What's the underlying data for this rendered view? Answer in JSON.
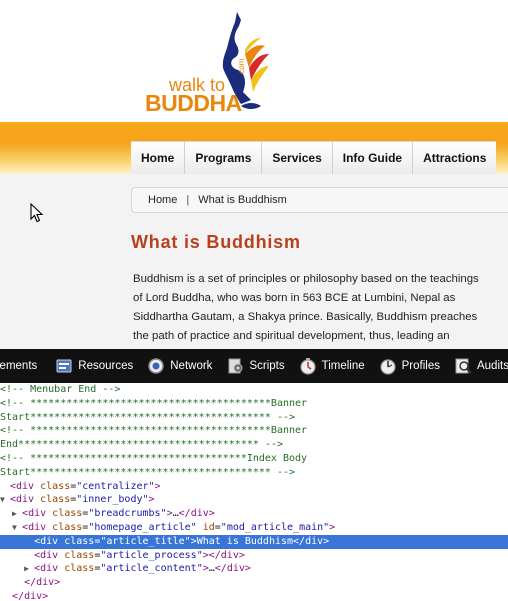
{
  "site": {
    "logo": {
      "line1": "walk to",
      "line2": "BUDDHA",
      "suffix": ".com"
    },
    "nav": [
      "Home",
      "Programs",
      "Services",
      "Info Guide",
      "Attractions"
    ],
    "breadcrumb": {
      "home": "Home",
      "separator": "|",
      "current": "What is Buddhism"
    },
    "title": "What is Buddhism",
    "article_lines": [
      "Buddhism is a set of principles or philosophy based on the teachings",
      "of Lord Buddha, who was born in 563 BCE at Lumbini, Nepal as",
      "Siddhartha Gautam, a Shakya prince. Basically, Buddhism preaches",
      "the path of practice and spiritual development, thus, leading an"
    ]
  },
  "devtools": {
    "tabs": [
      {
        "label": "lements",
        "icon": "elements-icon"
      },
      {
        "label": "Resources",
        "icon": "resources-icon"
      },
      {
        "label": "Network",
        "icon": "network-icon"
      },
      {
        "label": "Scripts",
        "icon": "scripts-icon"
      },
      {
        "label": "Timeline",
        "icon": "timeline-icon"
      },
      {
        "label": "Profiles",
        "icon": "profiles-icon"
      },
      {
        "label": "Audits",
        "icon": "audits-icon"
      }
    ],
    "dom_lines": [
      {
        "kind": "comment",
        "text": "<!-- Menubar End -->"
      },
      {
        "kind": "comment",
        "text": "<!-- ****************************************Banner"
      },
      {
        "kind": "comment",
        "text": "Start**************************************** -->"
      },
      {
        "kind": "comment",
        "text": "<!-- ****************************************Banner"
      },
      {
        "kind": "comment",
        "text": "End**************************************** -->"
      },
      {
        "kind": "comment",
        "text": "<!-- ************************************Index Body"
      },
      {
        "kind": "comment",
        "text": "Start**************************************** -->"
      },
      {
        "kind": "open",
        "indent": 0,
        "toggle": "",
        "tag": "div",
        "attrs": [
          [
            "class",
            "centralizer"
          ]
        ],
        "inner": ""
      },
      {
        "kind": "open",
        "indent": 0,
        "toggle": "▼",
        "tag": "div",
        "attrs": [
          [
            "class",
            "inner_body"
          ]
        ],
        "inner": ""
      },
      {
        "kind": "open",
        "indent": 1,
        "toggle": "▶",
        "tag": "div",
        "attrs": [
          [
            "class",
            "breadcrumbs"
          ]
        ],
        "inner": "…",
        "close": "div"
      },
      {
        "kind": "open",
        "indent": 1,
        "toggle": "▼",
        "tag": "div",
        "attrs": [
          [
            "class",
            "homepage_article"
          ],
          [
            "id",
            "mod_article_main"
          ]
        ],
        "inner": ""
      },
      {
        "kind": "open",
        "indent": 2,
        "toggle": "",
        "tag": "div",
        "attrs": [
          [
            "class",
            "article_title"
          ]
        ],
        "inner": "What is Buddhism",
        "close": "div",
        "selected": true
      },
      {
        "kind": "open",
        "indent": 2,
        "toggle": "",
        "tag": "div",
        "attrs": [
          [
            "class",
            "article_process"
          ]
        ],
        "inner": "",
        "close": "div"
      },
      {
        "kind": "open",
        "indent": 2,
        "toggle": "▶",
        "tag": "div",
        "attrs": [
          [
            "class",
            "article_content"
          ]
        ],
        "inner": "…",
        "close": "div"
      },
      {
        "kind": "closetag",
        "indent": 1,
        "tag": "div"
      },
      {
        "kind": "closetag",
        "indent": 0,
        "tag": "div"
      }
    ]
  }
}
